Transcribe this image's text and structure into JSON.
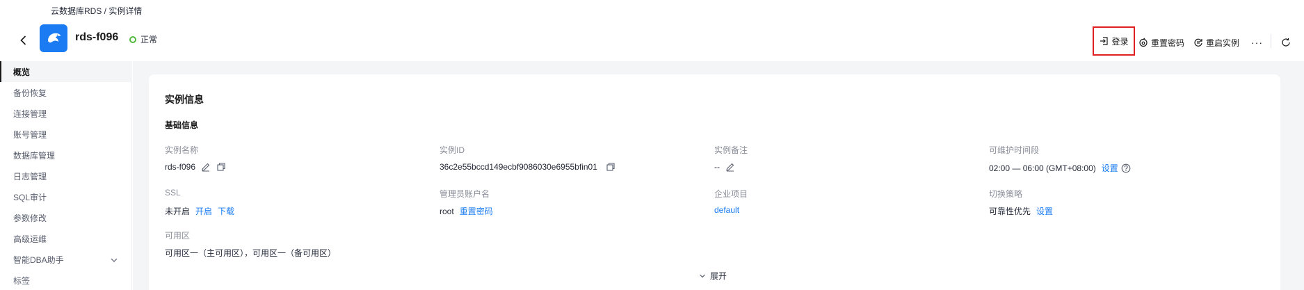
{
  "breadcrumb": "云数据库RDS / 实例详情",
  "header": {
    "instance_name": "rds-f096",
    "status": "正常",
    "actions": {
      "login": "登录",
      "reset_password": "重置密码",
      "restart": "重启实例",
      "more": "···"
    }
  },
  "sidebar": {
    "items": [
      {
        "label": "概览",
        "active": true
      },
      {
        "label": "备份恢复"
      },
      {
        "label": "连接管理"
      },
      {
        "label": "账号管理"
      },
      {
        "label": "数据库管理"
      },
      {
        "label": "日志管理"
      },
      {
        "label": "SQL审计"
      },
      {
        "label": "参数修改"
      },
      {
        "label": "高级运维"
      },
      {
        "label": "智能DBA助手"
      },
      {
        "label": "标签"
      }
    ]
  },
  "main": {
    "card_title": "实例信息",
    "section_title": "基础信息",
    "fields": {
      "name": {
        "label": "实例名称",
        "value": "rds-f096"
      },
      "id": {
        "label": "实例ID",
        "value": "36c2e55bccd149ecbf9086030e6955bfin01"
      },
      "remark": {
        "label": "实例备注",
        "value": "--"
      },
      "maintenance": {
        "label": "可维护时间段",
        "value": "02:00 — 06:00 (GMT+08:00)",
        "link": "设置"
      },
      "ssl": {
        "label": "SSL",
        "value": "未开启",
        "link_enable": "开启",
        "link_download": "下载"
      },
      "admin": {
        "label": "管理员账户名",
        "value": "root",
        "link": "重置密码"
      },
      "project": {
        "label": "企业项目",
        "value": "default"
      },
      "switch": {
        "label": "切换策略",
        "value": "可靠性优先",
        "link": "设置"
      },
      "az": {
        "label": "可用区",
        "value": "可用区一（主可用区），可用区一（备可用区）"
      }
    },
    "expand_label": "展开"
  },
  "colors": {
    "accent": "#1a7bf2",
    "status_ok": "#50b83c",
    "highlight_border": "#e02020"
  }
}
